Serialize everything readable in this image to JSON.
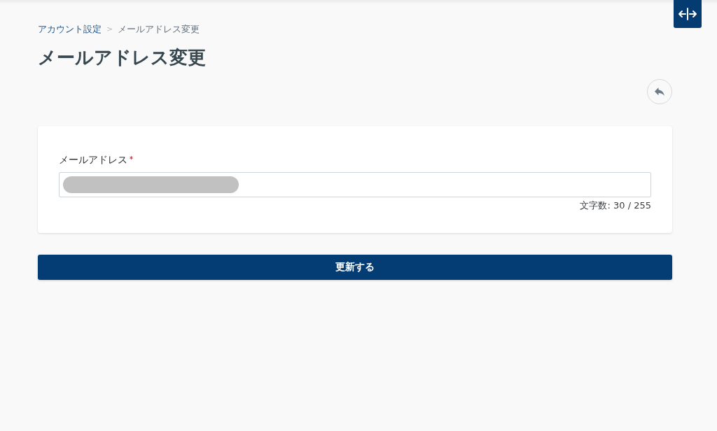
{
  "breadcrumb": {
    "items": [
      {
        "label": "アカウント設定",
        "kind": "link"
      },
      {
        "label": "メールアドレス変更",
        "kind": "current"
      }
    ],
    "separator": ">"
  },
  "page_title": "メールアドレス変更",
  "form": {
    "fields": [
      {
        "label": "メールアドレス",
        "required": true,
        "redacted": true,
        "counter": "文字数: 30 / 255"
      }
    ]
  },
  "submit_button": {
    "label": "更新する"
  }
}
